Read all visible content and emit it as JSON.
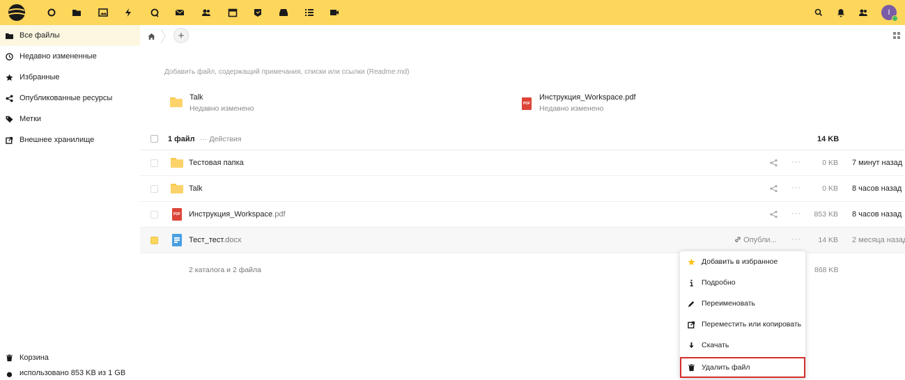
{
  "topbar": {
    "apps": [
      "home-icon",
      "folder-icon",
      "image-icon",
      "activity-icon",
      "talk-icon",
      "mail-icon",
      "contacts-icon",
      "calendar-icon",
      "deck-icon",
      "inbox-icon",
      "tasks-icon",
      "video-icon"
    ],
    "user_initial": "I",
    "accent": "#fdd65c"
  },
  "sidebar": {
    "items": [
      {
        "label": "Все файлы",
        "icon": "folder-icon"
      },
      {
        "label": "Недавно измененные",
        "icon": "clock-icon"
      },
      {
        "label": "Избранные",
        "icon": "star-icon"
      },
      {
        "label": "Опубликованные ресурсы",
        "icon": "share-icon"
      },
      {
        "label": "Метки",
        "icon": "tag-icon"
      },
      {
        "label": "Внешнее хранилище",
        "icon": "external-icon"
      }
    ],
    "trash": "Корзина",
    "quota": "использовано 853 KB из 1 GB"
  },
  "main": {
    "readme_placeholder": "Добавить файл, содержащий примечания, списки или ссылки (Readme.md)",
    "recent": [
      {
        "name": "Talk",
        "sub": "Недавно изменено",
        "type": "folder"
      },
      {
        "name": "Инструкция_Workspace.pdf",
        "sub": "Недавно изменено",
        "type": "pdf"
      }
    ],
    "header": {
      "count": "1 файл",
      "actions": "··· Действия",
      "size": "14 KB"
    },
    "files": [
      {
        "name": "Тестовая папка",
        "ext": "",
        "type": "folder",
        "size": "0 KB",
        "date": "7 минут назад"
      },
      {
        "name": "Talk",
        "ext": "",
        "type": "folder",
        "size": "0 KB",
        "date": "8 часов назад"
      },
      {
        "name": "Инструкция_Workspace",
        "ext": ".pdf",
        "type": "pdf",
        "size": "853 KB",
        "date": "8 часов назад"
      },
      {
        "name": "Тест_тест",
        "ext": ".docx",
        "type": "doc",
        "size": "14 KB",
        "date": "2 месяца назад",
        "published": "Опубли..."
      }
    ],
    "summary": "2 каталога и 2 файла",
    "summary_size": "868 KB",
    "pdf_badge": "PDF"
  },
  "context_menu": {
    "items": [
      {
        "label": "Добавить в избранное",
        "icon": "star-icon"
      },
      {
        "label": "Подробно",
        "icon": "info-icon"
      },
      {
        "label": "Переименовать",
        "icon": "pencil-icon"
      },
      {
        "label": "Переместить или копировать",
        "icon": "move-icon"
      },
      {
        "label": "Скачать",
        "icon": "download-icon"
      },
      {
        "label": "Удалить файл",
        "icon": "trash-icon"
      }
    ]
  }
}
